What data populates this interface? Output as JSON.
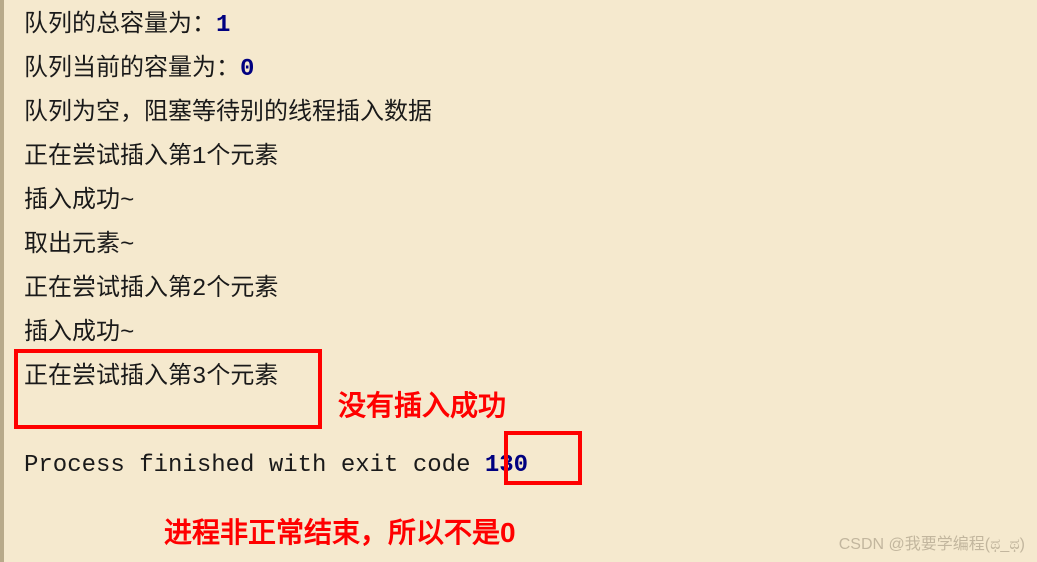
{
  "console": {
    "lines": [
      {
        "prefix": "队列的总容量为：",
        "value": "1",
        "suffix": ""
      },
      {
        "prefix": "队列当前的容量为：",
        "value": "0",
        "suffix": ""
      },
      {
        "prefix": "队列为空，阻塞等待别的线程插入数据",
        "value": "",
        "suffix": ""
      },
      {
        "prefix": "正在尝试插入第1个元素",
        "value": "",
        "suffix": ""
      },
      {
        "prefix": "插入成功~",
        "value": "",
        "suffix": ""
      },
      {
        "prefix": "取出元素~",
        "value": "",
        "suffix": ""
      },
      {
        "prefix": "正在尝试插入第2个元素",
        "value": "",
        "suffix": ""
      },
      {
        "prefix": "插入成功~",
        "value": "",
        "suffix": ""
      },
      {
        "prefix": "正在尝试插入第3个元素",
        "value": "",
        "suffix": ""
      }
    ],
    "process_prefix": "Process finished with exit code ",
    "process_code": "130"
  },
  "annotations": {
    "a1": "没有插入成功",
    "a2": "进程非正常结束，所以不是0"
  },
  "watermark": "CSDN @我要学编程(ಥ_ಥ)"
}
